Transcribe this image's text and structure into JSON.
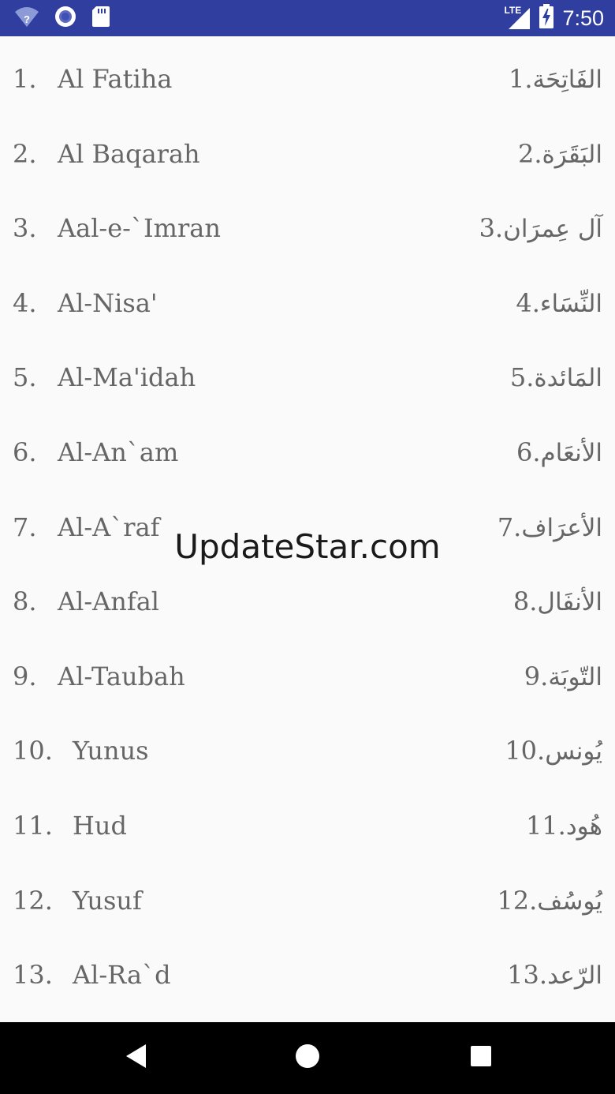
{
  "status_bar": {
    "time": "7:50",
    "network": "LTE",
    "icons": [
      "wifi-question-icon",
      "circle-app-icon",
      "sd-card-icon",
      "lte-signal-icon",
      "battery-charging-icon"
    ]
  },
  "surahs": [
    {
      "num": "1.",
      "name": "Al Fatiha",
      "arabic": "الفَاتِحَة",
      "ar_num": ".1"
    },
    {
      "num": "2.",
      "name": "Al Baqarah",
      "arabic": "البَقَرَة",
      "ar_num": ".2"
    },
    {
      "num": "3.",
      "name": "Aal-e-`Imran",
      "arabic": "آل عِمرَان",
      "ar_num": ".3"
    },
    {
      "num": "4.",
      "name": "Al-Nisa'",
      "arabic": "النِّسَاء",
      "ar_num": ".4"
    },
    {
      "num": "5.",
      "name": "Al-Ma'idah",
      "arabic": "المَائدة",
      "ar_num": ".5"
    },
    {
      "num": "6.",
      "name": "Al-An`am",
      "arabic": "الأنعَام",
      "ar_num": ".6"
    },
    {
      "num": "7.",
      "name": "Al-A`raf",
      "arabic": "الأعرَاف",
      "ar_num": ".7"
    },
    {
      "num": "8.",
      "name": "Al-Anfal",
      "arabic": "الأنفَال",
      "ar_num": ".8"
    },
    {
      "num": "9.",
      "name": "Al-Taubah",
      "arabic": "التّوبَة",
      "ar_num": ".9"
    },
    {
      "num": "10.",
      "name": "Yunus",
      "arabic": "يُونس",
      "ar_num": ".10"
    },
    {
      "num": "11.",
      "name": "Hud",
      "arabic": "هُود",
      "ar_num": ".11"
    },
    {
      "num": "12.",
      "name": "Yusuf",
      "arabic": "يُوسُف",
      "ar_num": ".12"
    },
    {
      "num": "13.",
      "name": "Al-Ra`d",
      "arabic": "الرّعد",
      "ar_num": ".13"
    }
  ],
  "watermark": "UpdateStar.com",
  "nav_bar": {
    "icons": [
      "back-icon",
      "home-icon",
      "recents-icon"
    ]
  }
}
